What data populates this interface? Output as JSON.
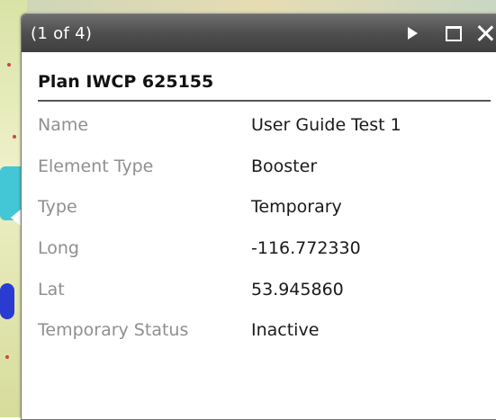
{
  "popup": {
    "page_indicator": "(1 of 4)",
    "title": "Plan IWCP 625155",
    "controls": {
      "next_icon": "play-next-icon",
      "maximize_icon": "maximize-icon",
      "close_icon": "close-icon"
    },
    "attributes": [
      {
        "label": "Name",
        "value": "User Guide Test 1"
      },
      {
        "label": "Element Type",
        "value": "Booster"
      },
      {
        "label": "Type",
        "value": "Temporary"
      },
      {
        "label": "Long",
        "value": "-116.772330"
      },
      {
        "label": "Lat",
        "value": "53.945860"
      },
      {
        "label": "Temporary Status",
        "value": "Inactive"
      }
    ]
  },
  "colors": {
    "titlebar": "#4e4e4e",
    "label": "#8f8f8f",
    "value": "#1a1a1a",
    "divider": "#555555"
  }
}
